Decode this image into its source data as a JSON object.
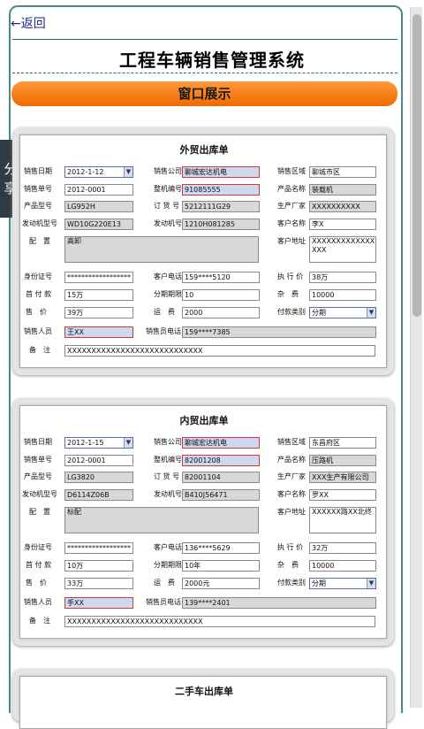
{
  "nav": {
    "back_label": "←返回"
  },
  "app": {
    "title": "工程车辆销售管理系统",
    "banner": "窗口展示"
  },
  "share": {
    "label1": "分",
    "label2": "享"
  },
  "labels": {
    "sale_date": "销售日期",
    "sale_company": "销售公司",
    "sale_region": "销售区域",
    "sale_no": "销售单号",
    "vehicle_no": "整机编号",
    "product_name": "产品名称",
    "product_model": "产品型号",
    "order_no": "订 货 号",
    "manufacturer": "生产厂家",
    "engine_model": "发动机型号",
    "engine_no": "发动机号",
    "customer_name": "客户名称",
    "config": "配　置",
    "customer_addr": "客户地址",
    "id_no": "身份证号",
    "customer_phone": "客户电话",
    "exec_price": "执 行 价",
    "down_payment": "首 付 款",
    "installments": "分期期限",
    "misc_fee": "杂　费",
    "price": "售　价",
    "freight": "运　费",
    "pay_type": "付款类别",
    "seller": "销售人员",
    "seller_phone": "销售员电话",
    "remark": "备　注"
  },
  "forms": [
    {
      "title": "外贸出库单",
      "sale_date": "2012-1-12",
      "sale_company": "聊城宏达机电",
      "sale_region": "聊城市区",
      "sale_no": "2012-0001",
      "vehicle_no": "91085555",
      "product_name": "装载机",
      "product_model": "LG952H",
      "order_no": "5212111G29",
      "manufacturer": "XXXXXXXXXX",
      "engine_model": "WD10G220E13",
      "engine_no": "1210H081285",
      "customer_name": "李X",
      "config": "高卸",
      "customer_addr": "XXXXXXXXXXXXXXXX",
      "id_no": "******************",
      "customer_phone": "159****5120",
      "exec_price": "38万",
      "down_payment": "15万",
      "installments": "10",
      "misc_fee": "10000",
      "price": "39万",
      "freight": "2000",
      "pay_type": "分期",
      "seller": "王XX",
      "seller_phone": "159****7385",
      "remark": "XXXXXXXXXXXXXXXXXXXXXXXXXXXX"
    },
    {
      "title": "内贸出库单",
      "sale_date": "2012-1-15",
      "sale_company": "聊城宏达机电",
      "sale_region": "东昌府区",
      "sale_no": "2012-0001",
      "vehicle_no": "82001208",
      "product_name": "压路机",
      "product_model": "LG3820",
      "order_no": "82001104",
      "manufacturer": "XXX生产有限公司",
      "engine_model": "D6114Z06B",
      "engine_no": "B410J56471",
      "customer_name": "罗XX",
      "config": "标配",
      "customer_addr": "XXXXXX路XX北终",
      "id_no": "******************",
      "customer_phone": "136****5629",
      "exec_price": "32万",
      "down_payment": "10万",
      "installments": "10年",
      "misc_fee": "10000",
      "price": "33万",
      "freight": "2000元",
      "pay_type": "分期",
      "seller": "手XX",
      "seller_phone": "139****2401",
      "remark": "XXXXXXXXXXXXXXXXXXXXXXXXXXXX"
    },
    {
      "title": "二手车出库单"
    }
  ]
}
